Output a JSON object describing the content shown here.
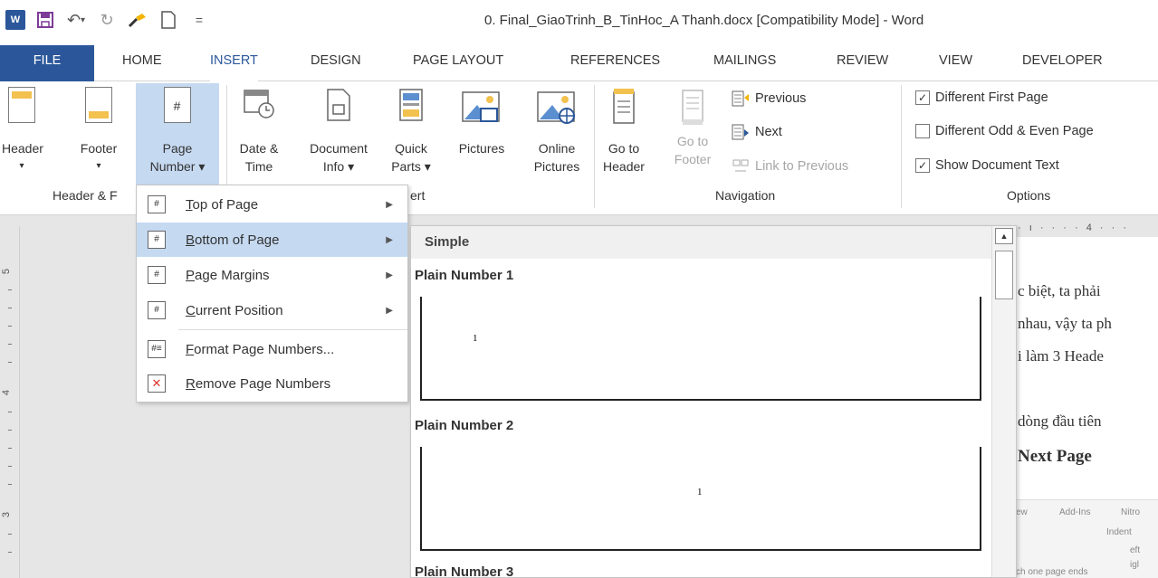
{
  "window": {
    "title": "0. Final_GiaoTrinh_B_TinHoc_A Thanh.docx [Compatibility Mode] - Word"
  },
  "qat": {
    "word_icon": "W",
    "save_icon": "save-icon",
    "undo_icon": "↶",
    "undo_arrow": "▾",
    "redo_icon": "↻",
    "format_painter_icon": "format-painter-icon",
    "new_icon": "new-document-icon",
    "customize": "="
  },
  "tabs": [
    "FILE",
    "HOME",
    "INSERT",
    "DESIGN",
    "PAGE LAYOUT",
    "REFERENCES",
    "MAILINGS",
    "REVIEW",
    "VIEW",
    "DEVELOPER"
  ],
  "ribbon": {
    "header": {
      "line1": "Header",
      "line2": "▾"
    },
    "footer": {
      "line1": "Footer",
      "line2": "▾"
    },
    "page_number": {
      "line1": "Page",
      "line2": "Number ▾"
    },
    "date_time": {
      "line1": "Date &",
      "line2": "Time"
    },
    "document_info": {
      "line1": "Document",
      "line2": "Info ▾"
    },
    "quick_parts": {
      "line1": "Quick",
      "line2": "Parts ▾"
    },
    "pictures": {
      "line1": "Pictures"
    },
    "online_pictures": {
      "line1": "Online",
      "line2": "Pictures"
    },
    "go_to_header": {
      "line1": "Go to",
      "line2": "Header"
    },
    "go_to_footer": {
      "line1": "Go to",
      "line2": "Footer"
    },
    "previous": "Previous",
    "next": "Next",
    "link_to_previous": "Link to Previous",
    "options": {
      "different_first_page": {
        "label": "Different First Page",
        "checked": true
      },
      "different_odd_even": {
        "label": "Different Odd & Even Page",
        "checked": false
      },
      "show_document_text": {
        "label": "Show Document Text",
        "checked": true
      }
    },
    "groups": {
      "header_footer": "Header & F",
      "insert": "ert",
      "navigation": "Navigation",
      "options": "Options"
    }
  },
  "menu": {
    "items": [
      {
        "label": "Top of Page",
        "accel": "T",
        "rest": "op of Page",
        "submenu": true
      },
      {
        "label": "Bottom of Page",
        "accel": "B",
        "rest": "ottom of Page",
        "submenu": true
      },
      {
        "label": "Page Margins",
        "accel": "P",
        "rest": "age Margins",
        "submenu": true
      },
      {
        "label": "Current Position",
        "accel": "C",
        "rest": "urrent Position",
        "submenu": true
      },
      {
        "label": "Format Page Numbers...",
        "accel": "F",
        "rest": "ormat Page Numbers...",
        "submenu": false
      },
      {
        "label": "Remove Page Numbers",
        "accel": "R",
        "rest": "emove Page Numbers",
        "submenu": false
      }
    ]
  },
  "gallery": {
    "category": "Simple",
    "items": [
      {
        "title": "Plain Number 1",
        "number": "1"
      },
      {
        "title": "Plain Number 2",
        "number": "1"
      },
      {
        "title": "Plain Number 3"
      }
    ]
  },
  "ruler": {
    "h_marks": "· ı · · · · 4 · · ·",
    "v_numbers": [
      "5",
      "4",
      "3"
    ]
  },
  "document": {
    "lines": [
      "c biệt, ta phải",
      "nhau, vậy ta ph",
      "i làm 3 Heade",
      "dòng đầu tiên"
    ],
    "heading": "Next Page",
    "mini_texts": [
      "ew",
      "Add-Ins",
      "Nitro",
      "Indent",
      "eft",
      "igl",
      "ch one page ends"
    ]
  }
}
